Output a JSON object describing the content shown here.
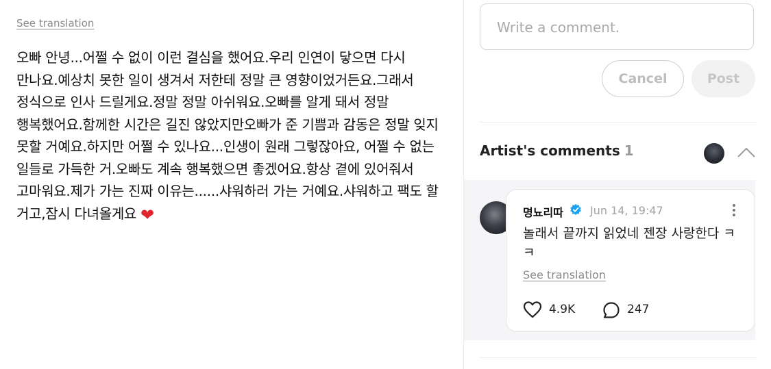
{
  "post": {
    "see_translation": "See translation",
    "body": "오빠 안녕...어쩔 수 없이 이런 결심을 했어요.우리 인연이 닿으면 다시 만나요.예상치 못한 일이 생겨서 저한테 정말 큰 영향이었거든요.그래서 정식으로 인사 드릴게요.정말 정말 아쉬워요.오빠를 알게 돼서 정말 행복했어요.함께한 시간은 길진 않았지만오빠가 준 기쁨과 감동은 정말 잊지 못할 거예요.하지만 어쩔 수 있나요...인생이 원래 그렇잖아요, 어쩔 수 없는 일들로 가득한 거.오빠도 계속 행복했으면 좋겠어요.항상 곁에 있어줘서 고마워요.제가 가는 진짜 이유는......샤워하러 가는 거예요.샤워하고 팩도 할 거고,잠시 다녀올게요",
    "emoji": "❤"
  },
  "comment_box": {
    "placeholder": "Write a comment.",
    "cancel_label": "Cancel",
    "post_label": "Post"
  },
  "artist_comments": {
    "title": "Artist's comments",
    "count": "1"
  },
  "comment": {
    "author": "명뇨리따",
    "timestamp": "Jun 14, 19:47",
    "text": "놀래서 끝까지 읽었네 젠장 사랑한다 ㅋㅋ",
    "see_translation": "See translation",
    "likes": "4.9K",
    "replies": "247"
  },
  "colors": {
    "heart": "#e0262c",
    "verified": "#1da1f2",
    "muted": "#8a8a8a"
  }
}
